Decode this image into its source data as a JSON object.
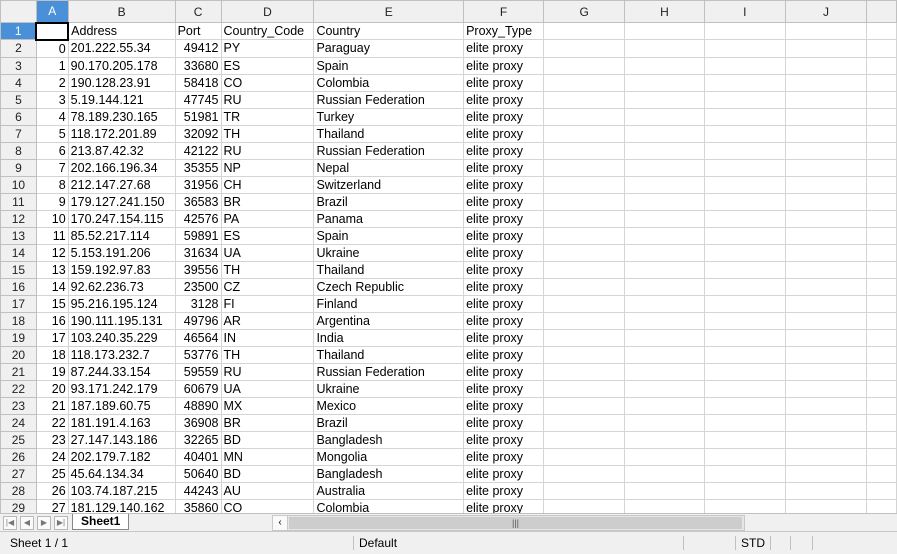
{
  "columns": [
    "A",
    "B",
    "C",
    "D",
    "E",
    "F",
    "G",
    "H",
    "I",
    "J"
  ],
  "header_row": [
    "",
    "Address",
    "Port",
    "Country_Code",
    "Country",
    "Proxy_Type"
  ],
  "rows": [
    [
      "0",
      "201.222.55.34",
      "49412",
      "PY",
      "Paraguay",
      "elite proxy"
    ],
    [
      "1",
      "90.170.205.178",
      "33680",
      "ES",
      "Spain",
      "elite proxy"
    ],
    [
      "2",
      "190.128.23.91",
      "58418",
      "CO",
      "Colombia",
      "elite proxy"
    ],
    [
      "3",
      "5.19.144.121",
      "47745",
      "RU",
      "Russian Federation",
      "elite proxy"
    ],
    [
      "4",
      "78.189.230.165",
      "51981",
      "TR",
      "Turkey",
      "elite proxy"
    ],
    [
      "5",
      "118.172.201.89",
      "32092",
      "TH",
      "Thailand",
      "elite proxy"
    ],
    [
      "6",
      "213.87.42.32",
      "42122",
      "RU",
      "Russian Federation",
      "elite proxy"
    ],
    [
      "7",
      "202.166.196.34",
      "35355",
      "NP",
      "Nepal",
      "elite proxy"
    ],
    [
      "8",
      "212.147.27.68",
      "31956",
      "CH",
      "Switzerland",
      "elite proxy"
    ],
    [
      "9",
      "179.127.241.150",
      "36583",
      "BR",
      "Brazil",
      "elite proxy"
    ],
    [
      "10",
      "170.247.154.115",
      "42576",
      "PA",
      "Panama",
      "elite proxy"
    ],
    [
      "11",
      "85.52.217.114",
      "59891",
      "ES",
      "Spain",
      "elite proxy"
    ],
    [
      "12",
      "5.153.191.206",
      "31634",
      "UA",
      "Ukraine",
      "elite proxy"
    ],
    [
      "13",
      "159.192.97.83",
      "39556",
      "TH",
      "Thailand",
      "elite proxy"
    ],
    [
      "14",
      "92.62.236.73",
      "23500",
      "CZ",
      "Czech Republic",
      "elite proxy"
    ],
    [
      "15",
      "95.216.195.124",
      "3128",
      "FI",
      "Finland",
      "elite proxy"
    ],
    [
      "16",
      "190.111.195.131",
      "49796",
      "AR",
      "Argentina",
      "elite proxy"
    ],
    [
      "17",
      "103.240.35.229",
      "46564",
      "IN",
      "India",
      "elite proxy"
    ],
    [
      "18",
      "118.173.232.7",
      "53776",
      "TH",
      "Thailand",
      "elite proxy"
    ],
    [
      "19",
      "87.244.33.154",
      "59559",
      "RU",
      "Russian Federation",
      "elite proxy"
    ],
    [
      "20",
      "93.171.242.179",
      "60679",
      "UA",
      "Ukraine",
      "elite proxy"
    ],
    [
      "21",
      "187.189.60.75",
      "48890",
      "MX",
      "Mexico",
      "elite proxy"
    ],
    [
      "22",
      "181.191.4.163",
      "36908",
      "BR",
      "Brazil",
      "elite proxy"
    ],
    [
      "23",
      "27.147.143.186",
      "32265",
      "BD",
      "Bangladesh",
      "elite proxy"
    ],
    [
      "24",
      "202.179.7.182",
      "40401",
      "MN",
      "Mongolia",
      "elite proxy"
    ],
    [
      "25",
      "45.64.134.34",
      "50640",
      "BD",
      "Bangladesh",
      "elite proxy"
    ],
    [
      "26",
      "103.74.187.215",
      "44243",
      "AU",
      "Australia",
      "elite proxy"
    ],
    [
      "27",
      "181.129.140.162",
      "35860",
      "CO",
      "Colombia",
      "elite proxy"
    ]
  ],
  "tabs": {
    "sheet1": "Sheet1"
  },
  "status": {
    "sheet": "Sheet 1 / 1",
    "style": "Default",
    "mode": "STD"
  },
  "colors": {
    "selected_header": "#4a90d9"
  }
}
